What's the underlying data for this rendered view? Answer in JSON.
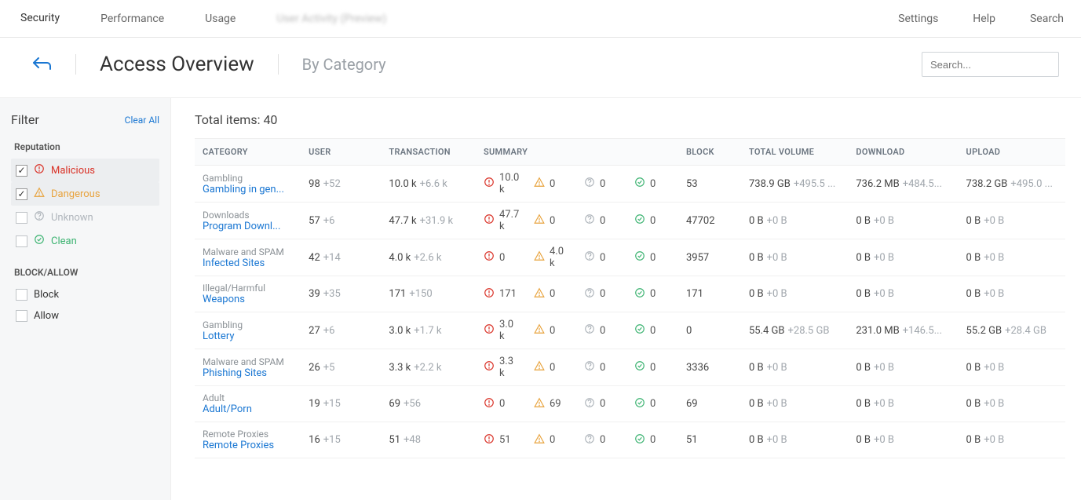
{
  "nav": {
    "tabs": [
      "Security",
      "Performance",
      "Usage",
      "User Activity (Preview)"
    ],
    "active": 0,
    "right": [
      "Settings",
      "Help",
      "Search"
    ]
  },
  "header": {
    "title": "Access Overview",
    "subtitle": "By Category",
    "search_placeholder": "Search..."
  },
  "sidebar": {
    "title": "Filter",
    "clear": "Clear All",
    "reputation_label": "Reputation",
    "reputation": [
      {
        "label": "Malicious",
        "checked": true,
        "icon": "mal"
      },
      {
        "label": "Dangerous",
        "checked": true,
        "icon": "dan"
      },
      {
        "label": "Unknown",
        "checked": false,
        "icon": "unk"
      },
      {
        "label": "Clean",
        "checked": false,
        "icon": "cln"
      }
    ],
    "block_label": "BLOCK/ALLOW",
    "block": [
      {
        "label": "Block",
        "checked": false
      },
      {
        "label": "Allow",
        "checked": false
      }
    ]
  },
  "total_label": "Total items: 40",
  "columns": [
    "CATEGORY",
    "USER",
    "TRANSACTION",
    "SUMMARY",
    "BLOCK",
    "TOTAL VOLUME",
    "DOWNLOAD",
    "UPLOAD"
  ],
  "rows": [
    {
      "group": "Gambling",
      "name": "Gambling in gen...",
      "user": "98",
      "user_d": "+52",
      "tx": "10.0 k",
      "tx_d": "+6.6 k",
      "mal": "10.0 k",
      "dan": "0",
      "unk": "0",
      "cln": "0",
      "block": "53",
      "tv": "738.9 GB",
      "tv_d": "+495.5 ...",
      "dl": "736.2 MB",
      "dl_d": "+484.5...",
      "ul": "738.2 GB",
      "ul_d": "+495.0 ..."
    },
    {
      "group": "Downloads",
      "name": "Program Downl...",
      "user": "57",
      "user_d": "+6",
      "tx": "47.7 k",
      "tx_d": "+31.9 k",
      "mal": "47.7 k",
      "dan": "0",
      "unk": "0",
      "cln": "0",
      "block": "47702",
      "tv": "0 B",
      "tv_d": "+0 B",
      "dl": "0 B",
      "dl_d": "+0 B",
      "ul": "0 B",
      "ul_d": "+0 B"
    },
    {
      "group": "Malware and SPAM",
      "name": "Infected Sites",
      "user": "42",
      "user_d": "+14",
      "tx": "4.0 k",
      "tx_d": "+2.6 k",
      "mal": "0",
      "dan": "4.0 k",
      "unk": "0",
      "cln": "0",
      "block": "3957",
      "tv": "0 B",
      "tv_d": "+0 B",
      "dl": "0 B",
      "dl_d": "+0 B",
      "ul": "0 B",
      "ul_d": "+0 B"
    },
    {
      "group": "Illegal/Harmful",
      "name": "Weapons",
      "user": "39",
      "user_d": "+35",
      "tx": "171",
      "tx_d": "+150",
      "mal": "171",
      "dan": "0",
      "unk": "0",
      "cln": "0",
      "block": "171",
      "tv": "0 B",
      "tv_d": "+0 B",
      "dl": "0 B",
      "dl_d": "+0 B",
      "ul": "0 B",
      "ul_d": "+0 B"
    },
    {
      "group": "Gambling",
      "name": "Lottery",
      "user": "27",
      "user_d": "+6",
      "tx": "3.0 k",
      "tx_d": "+1.7 k",
      "mal": "3.0 k",
      "dan": "0",
      "unk": "0",
      "cln": "0",
      "block": "0",
      "tv": "55.4 GB",
      "tv_d": "+28.5 GB",
      "dl": "231.0 MB",
      "dl_d": "+146.5...",
      "ul": "55.2 GB",
      "ul_d": "+28.4 GB"
    },
    {
      "group": "Malware and SPAM",
      "name": "Phishing Sites",
      "user": "26",
      "user_d": "+5",
      "tx": "3.3 k",
      "tx_d": "+2.2 k",
      "mal": "3.3 k",
      "dan": "0",
      "unk": "0",
      "cln": "0",
      "block": "3336",
      "tv": "0 B",
      "tv_d": "+0 B",
      "dl": "0 B",
      "dl_d": "+0 B",
      "ul": "0 B",
      "ul_d": "+0 B"
    },
    {
      "group": "Adult",
      "name": "Adult/Porn",
      "user": "19",
      "user_d": "+15",
      "tx": "69",
      "tx_d": "+56",
      "mal": "0",
      "dan": "69",
      "unk": "0",
      "cln": "0",
      "block": "69",
      "tv": "0 B",
      "tv_d": "+0 B",
      "dl": "0 B",
      "dl_d": "+0 B",
      "ul": "0 B",
      "ul_d": "+0 B"
    },
    {
      "group": "Remote Proxies",
      "name": "Remote Proxies",
      "user": "16",
      "user_d": "+15",
      "tx": "51",
      "tx_d": "+48",
      "mal": "51",
      "dan": "0",
      "unk": "0",
      "cln": "0",
      "block": "51",
      "tv": "0 B",
      "tv_d": "+0 B",
      "dl": "0 B",
      "dl_d": "+0 B",
      "ul": "0 B",
      "ul_d": "+0 B"
    }
  ]
}
